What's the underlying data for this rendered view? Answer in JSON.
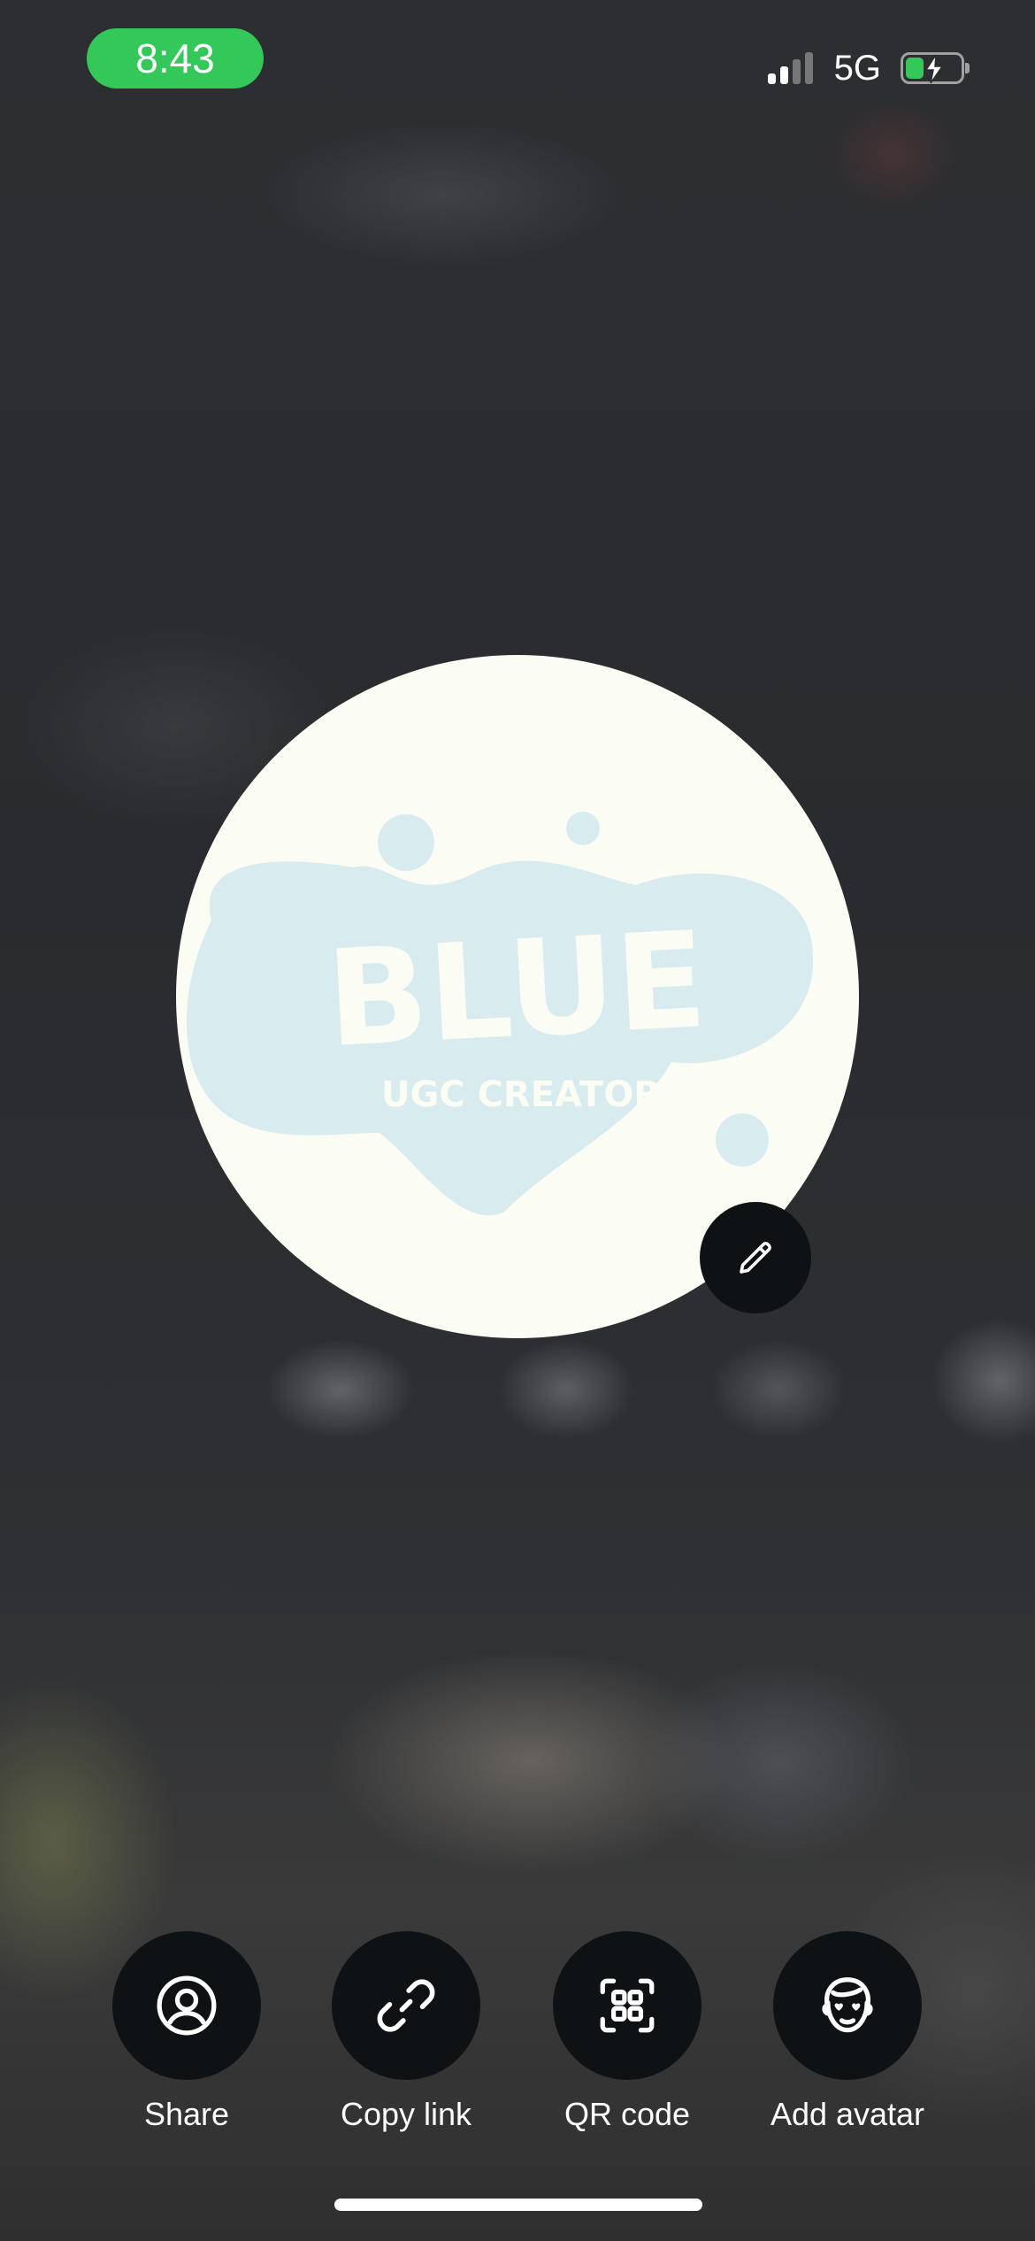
{
  "status_bar": {
    "time": "8:43",
    "network": "5G",
    "signal_bars_active": 2,
    "signal_bars_total": 4,
    "battery_level": 0.3,
    "charging": true,
    "time_pill_color": "#34c759"
  },
  "avatar": {
    "logo_text": "BLUE",
    "logo_subtext": "UGC CREATOR",
    "background_color": "#fbfcf3",
    "blob_color": "#d8ecf0",
    "edit_icon": "pencil-icon"
  },
  "actions": [
    {
      "label": "Share",
      "icon": "user-circle-icon"
    },
    {
      "label": "Copy link",
      "icon": "link-icon"
    },
    {
      "label": "QR code",
      "icon": "qr-code-icon"
    },
    {
      "label": "Add avatar",
      "icon": "avatar-face-icon"
    }
  ]
}
